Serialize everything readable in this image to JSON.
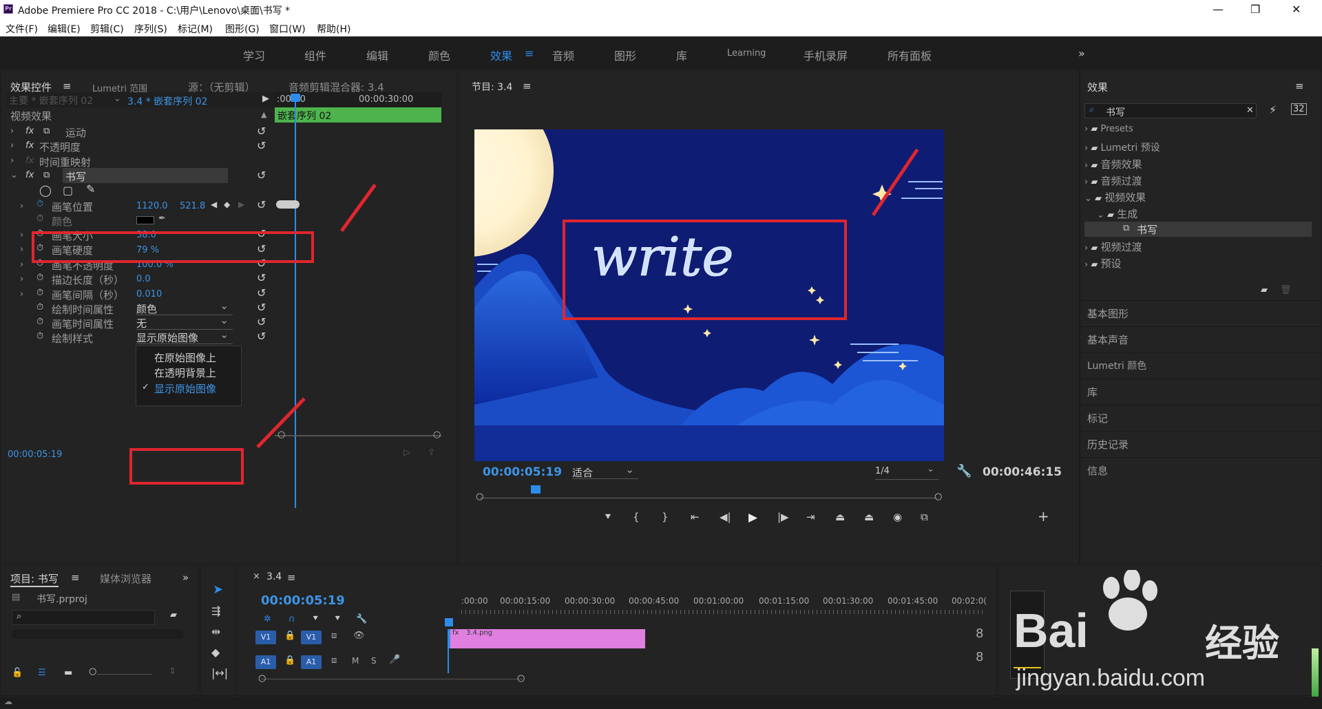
{
  "window": {
    "title": "Adobe Premiere Pro CC 2018 - C:\\用户\\Lenovo\\桌面\\书写 *",
    "app_icon": "Pr"
  },
  "menu": [
    "文件(F)",
    "编辑(E)",
    "剪辑(C)",
    "序列(S)",
    "标记(M)",
    "图形(G)",
    "窗口(W)",
    "帮助(H)"
  ],
  "workspaces": [
    "学习",
    "组件",
    "编辑",
    "颜色",
    "效果",
    "音频",
    "图形",
    "库",
    "Learning",
    "手机录屏",
    "所有面板"
  ],
  "active_workspace": "效果",
  "effect_controls": {
    "tabs": [
      "效果控件",
      "Lumetri 范围",
      "源：（无剪辑）",
      "音频剪辑混合器: 3.4"
    ],
    "master": "主要 * 嵌套序列 02",
    "sequence": "3.4 * 嵌套序列 02",
    "ruler_start": ":00:00",
    "ruler_mid": "00:00:30:00",
    "clip_name": "嵌套序列 02",
    "section": "视频效果",
    "effects": [
      "运动",
      "不透明度",
      "时间重映射",
      "书写"
    ],
    "params": [
      {
        "label": "画笔位置",
        "v1": "1120.0",
        "v2": "521.8"
      },
      {
        "label": "颜色",
        "v1": ""
      },
      {
        "label": "画笔大小",
        "v1": "38.0"
      },
      {
        "label": "画笔硬度",
        "v1": "79 %"
      },
      {
        "label": "画笔不透明度",
        "v1": "100.0 %"
      },
      {
        "label": "描边长度（秒）",
        "v1": "0.0"
      },
      {
        "label": "画笔间隔（秒）",
        "v1": "0.010"
      }
    ],
    "dropdowns": [
      {
        "label": "绘制时间属性",
        "value": "颜色"
      },
      {
        "label": "画笔时间属性",
        "value": "无"
      },
      {
        "label": "绘制样式",
        "value": "显示原始图像"
      }
    ],
    "menu_options": [
      "在原始图像上",
      "在透明背景上",
      "显示原始图像"
    ],
    "timecode": "00:00:05:19"
  },
  "program": {
    "title": "节目: 3.4",
    "preview_text": "write",
    "timecode": "00:00:05:19",
    "fit": "适合",
    "quality": "1/4",
    "duration": "00:00:46:15"
  },
  "effects_panel": {
    "title": "效果",
    "search": "书写",
    "tree": [
      {
        "label": "Presets",
        "indent": 0,
        "type": "folder-star"
      },
      {
        "label": "Lumetri 预设",
        "indent": 0,
        "type": "folder-star"
      },
      {
        "label": "音频效果",
        "indent": 0,
        "type": "folder"
      },
      {
        "label": "音频过渡",
        "indent": 0,
        "type": "folder"
      },
      {
        "label": "视频效果",
        "indent": 0,
        "type": "folder",
        "open": true
      },
      {
        "label": "生成",
        "indent": 1,
        "type": "folder",
        "open": true
      },
      {
        "label": "书写",
        "indent": 2,
        "type": "effect",
        "selected": true
      },
      {
        "label": "视频过渡",
        "indent": 0,
        "type": "folder"
      },
      {
        "label": "预设",
        "indent": 0,
        "type": "folder"
      }
    ],
    "other_panels": [
      "基本图形",
      "基本声音",
      "Lumetri 颜色",
      "库",
      "标记",
      "历史记录",
      "信息"
    ]
  },
  "project": {
    "tabs": [
      "项目: 书写",
      "媒体浏览器"
    ],
    "file": "书写.prproj"
  },
  "timeline": {
    "title": "3.4",
    "timecode": "00:00:05:19",
    "ruler": [
      ":00:00",
      "00:00:15:00",
      "00:00:30:00",
      "00:00:45:00",
      "00:01:00:00",
      "00:01:15:00",
      "00:01:30:00",
      "00:01:45:00",
      "00:02:0("
    ],
    "clip": "3.4.png",
    "tracks": [
      "V1",
      "A1"
    ]
  },
  "watermark": {
    "main": "Bai",
    "sub": "经验",
    "url": "jingyan.baidu.com"
  },
  "colors": {
    "accent": "#2d8ceb",
    "highlight_red": "#e0262f",
    "clip_green": "#4caf50",
    "clip_pink": "#e07fe0"
  }
}
